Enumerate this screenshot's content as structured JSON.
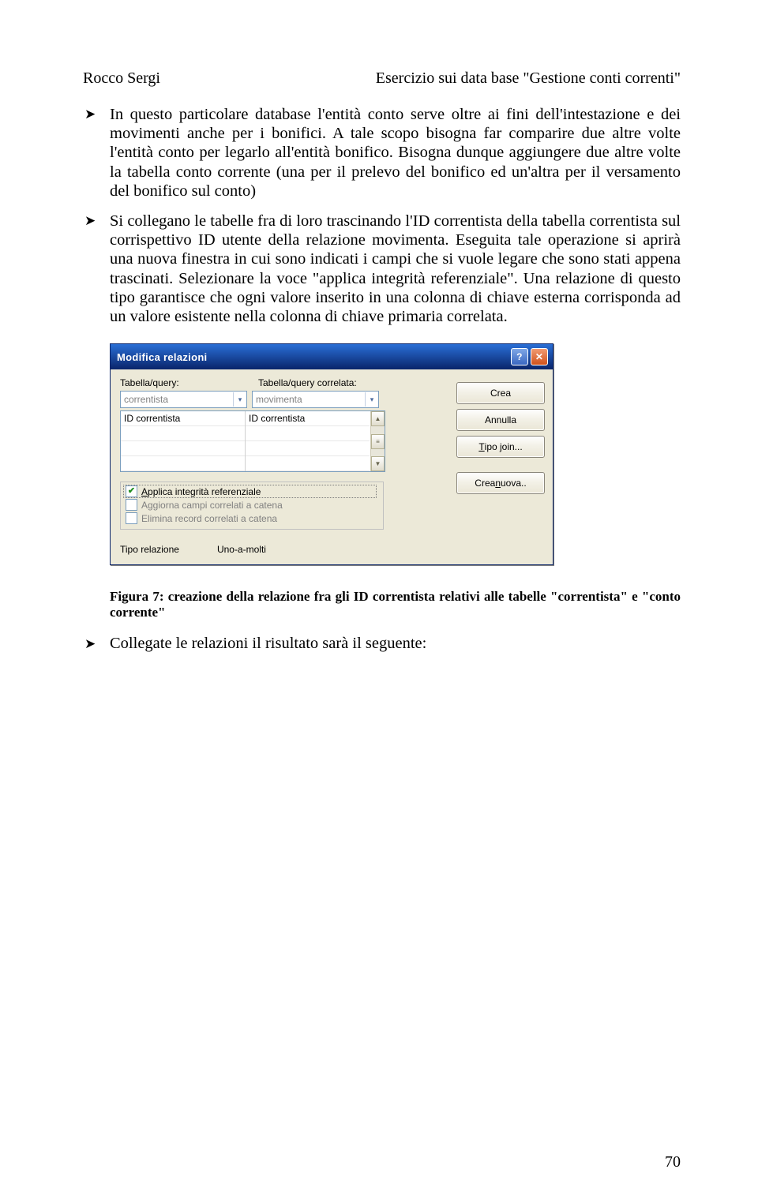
{
  "header": {
    "left": "Rocco Sergi",
    "right": "Esercizio sui data base \"Gestione conti correnti\""
  },
  "paragraphs": {
    "p1": "In questo particolare database l'entità conto serve oltre ai fini dell'intestazione e dei movimenti anche per i bonifici. A tale scopo bisogna far comparire due altre volte l'entità conto per legarlo all'entità bonifico. Bisogna dunque aggiungere due altre volte la tabella conto corrente (una per il prelevo del bonifico ed un'altra per il versamento del bonifico sul conto)",
    "p2": "Si collegano le tabelle fra di loro trascinando l'ID correntista della tabella correntista sul corrispettivo ID utente della relazione movimenta. Eseguita tale operazione si aprirà una nuova finestra in cui sono indicati i campi che si vuole legare che sono stati appena trascinati. Selezionare la voce \"applica integrità referenziale\". Una relazione di questo tipo garantisce che ogni valore inserito in una colonna di chiave esterna corrisponda ad un valore esistente nella colonna di chiave primaria correlata."
  },
  "dialog": {
    "title": "Modifica relazioni",
    "labels": {
      "left": "Tabella/query:",
      "right": "Tabella/query correlata:"
    },
    "dropdowns": {
      "left": "correntista",
      "right": "movimenta"
    },
    "grid": {
      "leftCell": "ID correntista",
      "rightCell": "ID correntista"
    },
    "checks": {
      "c1": "Applica integrità referenziale",
      "c2": "Aggiorna campi correlati a catena",
      "c3": "Elimina record correlati a catena"
    },
    "reltype": {
      "label": "Tipo relazione",
      "value": "Uno-a-molti"
    },
    "buttons": {
      "create": "Crea",
      "cancel": "Annulla",
      "joinType": "Tipo join...",
      "createNew": "Crea nuova.."
    }
  },
  "caption": "Figura 7: creazione della relazione fra gli ID correntista relativi alle tabelle \"correntista\" e \"conto corrente\"",
  "lastLine": "Collegate le relazioni il risultato sarà il seguente:",
  "pageNumber": "70"
}
